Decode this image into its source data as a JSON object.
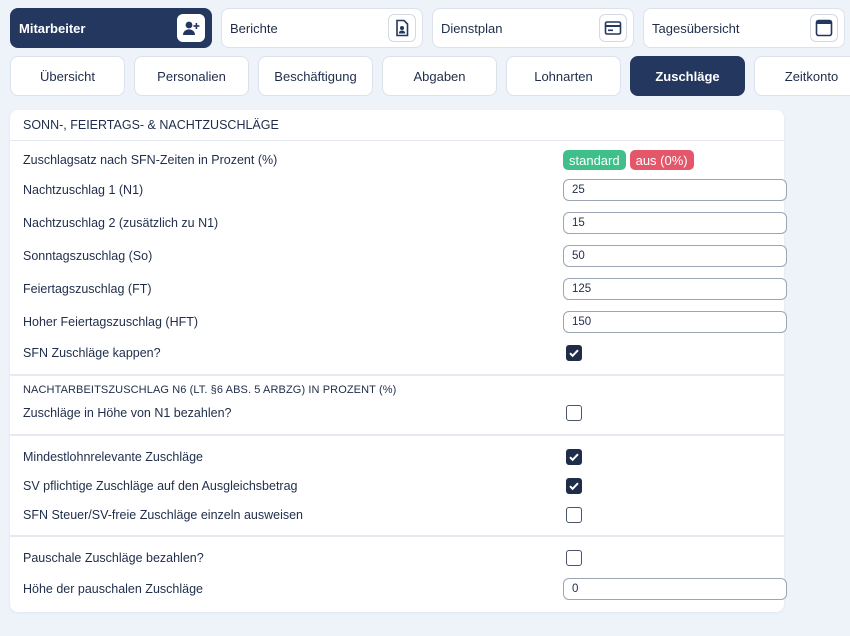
{
  "top_tabs": [
    {
      "label": "Mitarbeiter",
      "icon": "add-user-icon",
      "active": true
    },
    {
      "label": "Berichte",
      "icon": "document-icon",
      "active": false
    },
    {
      "label": "Dienstplan",
      "icon": "calendar-card-icon",
      "active": false
    },
    {
      "label": "Tagesübersicht",
      "icon": "window-icon",
      "active": false
    }
  ],
  "sub_tabs": [
    {
      "label": "Übersicht"
    },
    {
      "label": "Personalien"
    },
    {
      "label": "Beschäftigung"
    },
    {
      "label": "Abgaben"
    },
    {
      "label": "Lohnarten"
    },
    {
      "label": "Zuschläge",
      "active": true
    },
    {
      "label": "Zeitkonto"
    }
  ],
  "panel": {
    "title": "SONN-, FEIERTAGS- & NACHTZUSCHLÄGE",
    "rate_row": {
      "label": "Zuschlagsatz nach SFN-Zeiten in Prozent (%)",
      "badge_standard": "standard",
      "badge_off": "aus (0%)"
    },
    "fields": [
      {
        "label": "Nachtzuschlag 1 (N1)",
        "value": "25"
      },
      {
        "label": "Nachtzuschlag 2 (zusätzlich zu N1)",
        "value": "15"
      },
      {
        "label": "Sonntagszuschlag (So)",
        "value": "50"
      },
      {
        "label": "Feiertagszuschlag (FT)",
        "value": "125"
      },
      {
        "label": "Hoher Feiertagszuschlag (HFT)",
        "value": "150"
      }
    ],
    "cap": {
      "label": "SFN Zuschläge kappen?",
      "checked": true
    },
    "n6": {
      "title": "NACHTARBEITSZUSCHLAG N6 (LT. §6 ABS. 5 ARBZG) IN PROZENT (%)",
      "pay_label": "Zuschläge in Höhe von N1 bezahlen?",
      "pay_checked": false
    },
    "mindest": {
      "label": "Mindestlohnrelevante Zuschläge",
      "checked": true
    },
    "sv": {
      "label": "SV pflichtige Zuschläge auf den Ausgleichsbetrag",
      "checked": true
    },
    "sfn_free": {
      "label": "SFN Steuer/SV-freie Zuschläge einzeln ausweisen",
      "checked": false
    },
    "pauschal": {
      "label": "Pauschale Zuschläge bezahlen?",
      "checked": false
    },
    "pauschal_amount": {
      "label": "Höhe der pauschalen Zuschläge",
      "value": "0"
    }
  },
  "colors": {
    "primary": "#24375f",
    "standard": "#3fbf8a",
    "off": "#e4576a",
    "background": "#eef3fa"
  }
}
